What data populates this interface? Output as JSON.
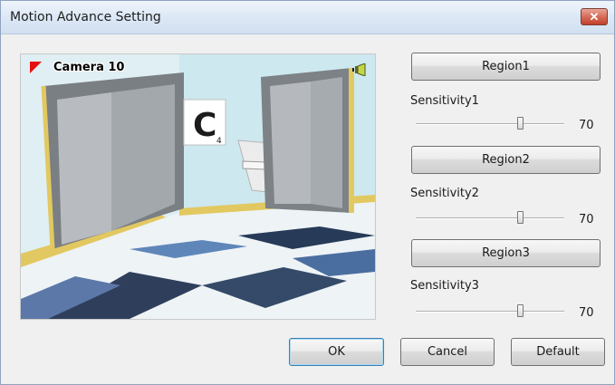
{
  "window": {
    "title": "Motion Advance Setting",
    "close_symbol": "✕"
  },
  "preview": {
    "camera_label": "Camera 10",
    "scene_sign": "C",
    "scene_sign_sub": "4"
  },
  "regions": [
    {
      "button_label": "Region1",
      "sensitivity_label": "Sensitivity1",
      "value": "70",
      "level_percent": 70
    },
    {
      "button_label": "Region2",
      "sensitivity_label": "Sensitivity2",
      "value": "70",
      "level_percent": 70
    },
    {
      "button_label": "Region3",
      "sensitivity_label": "Sensitivity3",
      "value": "70",
      "level_percent": 70
    }
  ],
  "buttons": {
    "ok": "OK",
    "cancel": "Cancel",
    "default": "Default"
  },
  "colors": {
    "flag": "#e61010",
    "close": "#c2412b",
    "focus": "#3c7fb1"
  }
}
